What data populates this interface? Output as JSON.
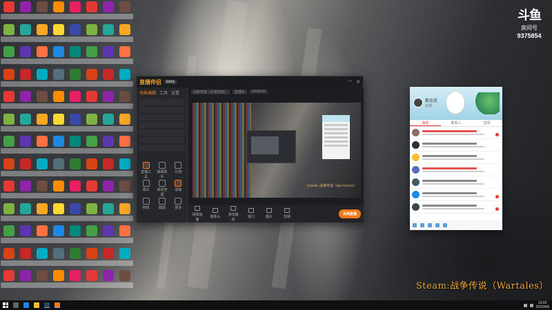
{
  "desktop": {
    "icon_colors": [
      "#e53935",
      "#2e7d32",
      "#1e88e5",
      "#f9a825",
      "#8e24aa",
      "#d84315",
      "#00897b",
      "#fdd835",
      "#6d4c41",
      "#c62828",
      "#43a047",
      "#3949ab",
      "#fb8c00",
      "#00acc1",
      "#5e35b1",
      "#7cb342",
      "#e91e63",
      "#546e7a",
      "#ff7043",
      "#26a69a"
    ]
  },
  "douyu": {
    "logo_text": "斗鱼",
    "sub_text": "房间号",
    "room_number": "9375854"
  },
  "stream_app": {
    "title": "直播伴侣",
    "version": "beta",
    "side_tabs": [
      "场景编辑",
      "工具",
      "设置"
    ],
    "tools": [
      "直播工具",
      "弹幕助手",
      "礼物",
      "观众",
      "房间管理",
      "录像",
      "特效",
      "截图",
      "更多"
    ],
    "info_pills": [
      "战争传说（大佬游戏）",
      "直播中",
      "00:00:00"
    ],
    "preview_caption": "Steam:战争传说（Wartales）",
    "toolbar": [
      "场景画面",
      "摄像头",
      "游戏捕获",
      "窗口",
      "图片",
      "音频"
    ],
    "go_live_label": "关闭直播"
  },
  "chat": {
    "nickname": "斯达克",
    "status": "在线",
    "tabs": [
      "消息",
      "联系人",
      "空间"
    ]
  },
  "game_caption": "Steam:战争传说（Wartales）",
  "taskbar": {
    "time": "13:02",
    "date": "2022/4/9"
  }
}
